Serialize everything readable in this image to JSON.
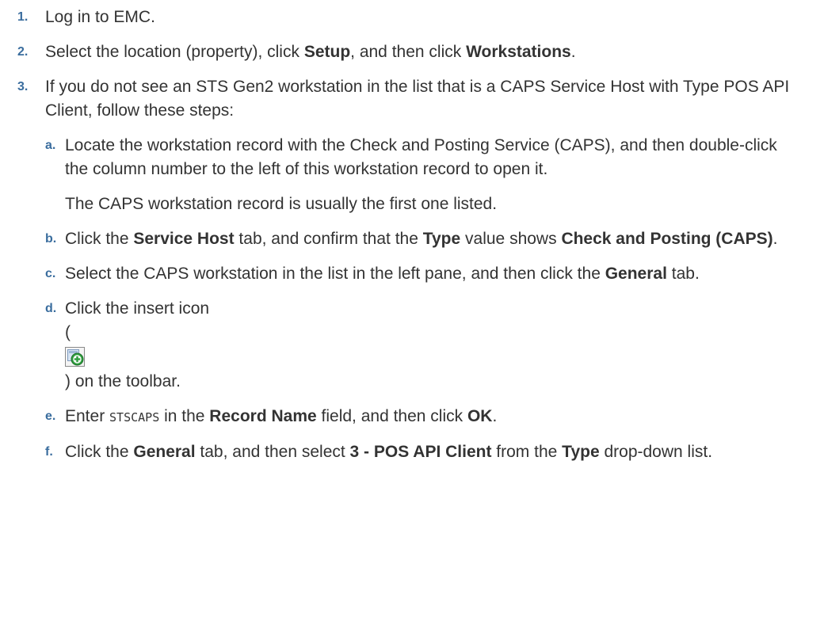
{
  "steps": [
    {
      "num": "1.",
      "text": "Log in to EMC."
    },
    {
      "num": "2.",
      "t1": "Select the location (property), click ",
      "b1": "Setup",
      "t2": ", and then click ",
      "b2": "Workstations",
      "t3": "."
    },
    {
      "num": "3.",
      "text": "If you do not see an STS Gen2 workstation in the list that is a CAPS Service Host with Type POS API Client, follow these steps:",
      "substeps": [
        {
          "letter": "a.",
          "text": "Locate the workstation record with the Check and Posting Service (CAPS), and then double-click the column number to the left of this workstation record to open it.",
          "note": "The CAPS workstation record is usually the first one listed."
        },
        {
          "letter": "b.",
          "t1": "Click the ",
          "b1": "Service Host",
          "t2": " tab, and confirm that the ",
          "b2": "Type",
          "t3": " value shows ",
          "b3": "Check and Posting (CAPS)",
          "t4": "."
        },
        {
          "letter": "c.",
          "t1": "Select the CAPS workstation in the list in the left pane, and then click the ",
          "b1": "General",
          "t2": " tab."
        },
        {
          "letter": "d.",
          "t1": "Click the insert icon",
          "t2": "(",
          "t3": ") on the toolbar."
        },
        {
          "letter": "e.",
          "t1": "Enter ",
          "code": "STSCAPS",
          "t2": " in the ",
          "b1": "Record Name",
          "t3": " field, and then click ",
          "b2": "OK",
          "t4": "."
        },
        {
          "letter": "f.",
          "t1": "Click the ",
          "b1": "General",
          "t2": " tab, and then select ",
          "b2": "3 - POS API Client",
          "t3": " from the ",
          "b3": "Type",
          "t4": " drop-down list."
        }
      ]
    }
  ],
  "colors": {
    "number": "#3a6d9e",
    "text": "#333333",
    "icon_plus": "#2e9e3e"
  },
  "icons": {
    "insert": "insert-icon"
  }
}
